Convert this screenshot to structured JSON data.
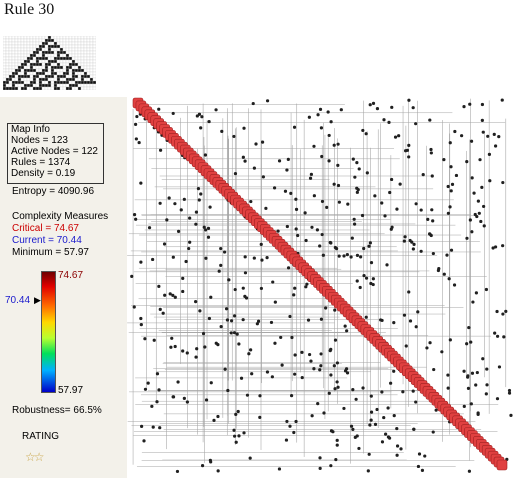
{
  "title": "Rule 30",
  "map_info": {
    "header": "Map Info",
    "nodes": "Nodes = 123",
    "active_nodes": "Active Nodes = 122",
    "rules": "Rules = 1374",
    "density": "Density = 0.19"
  },
  "entropy": "Entropy = 4090.96",
  "complexity": {
    "header": "Complexity Measures",
    "critical": "Critical = 74.67",
    "current": "Current = 70.44",
    "minimum": "Minimum = 57.97"
  },
  "scale": {
    "max_label": "74.67",
    "min_label": "57.97",
    "current_label": "70.44",
    "max_value": 74.67,
    "min_value": 57.97,
    "current_value": 70.44
  },
  "robustness": "Robustness= 66.5%",
  "rating": {
    "label": "RATING",
    "stars": "☆☆",
    "value": 2
  },
  "colors": {
    "critical": "#cc0000",
    "current": "#1a1acc",
    "diagonal": "#e04040",
    "star": "#c9a64a"
  }
}
